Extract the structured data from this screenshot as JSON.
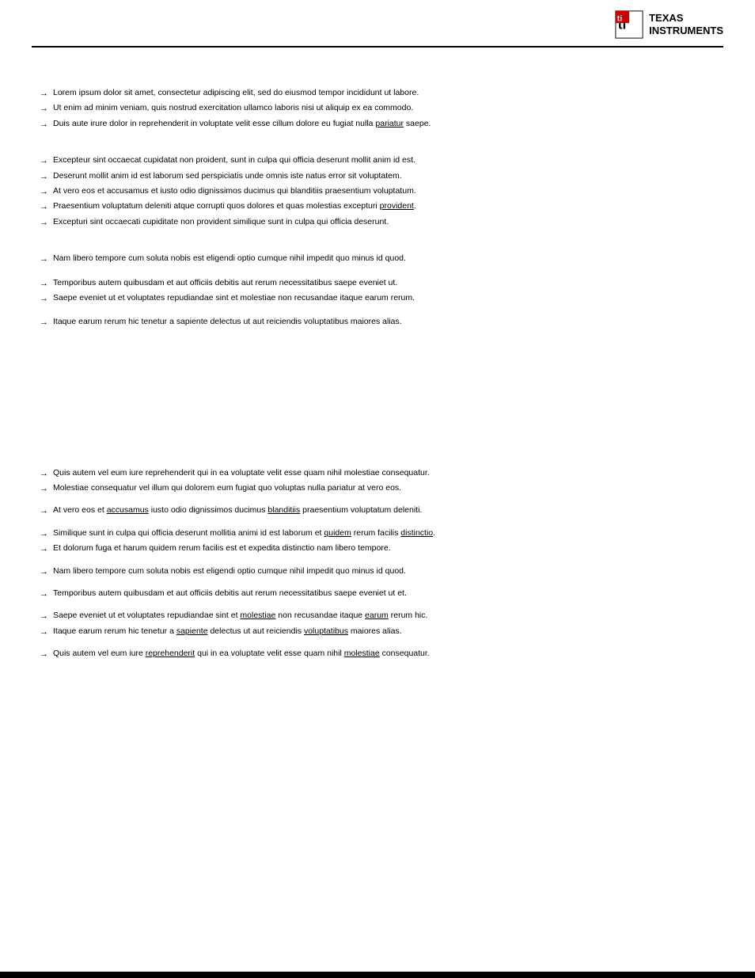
{
  "header": {
    "logo_text_line1": "TEXAS",
    "logo_text_line2": "INSTRUMENTS"
  },
  "top_rule": true,
  "sections": [
    {
      "id": "section1",
      "spacer_top": true,
      "title": "",
      "paragraphs": [],
      "bullets_groups": [
        {
          "items": [
            "Lorem ipsum dolor sit amet, consectetur adipiscing elit, sed do eiusmod tempor.",
            "Ut enim ad minim veniam, quis nostrud exercitation ullamco laboris nisi.",
            "Duis aute irure dolor in reprehenderit in voluptate velit esse cillum dolore eu fugiat nulla pariatur."
          ],
          "underline_word": "pariatur"
        }
      ]
    },
    {
      "id": "section2",
      "bullets_groups": [
        {
          "items": [
            "Excepteur sint occaecat cupidatat non proident, sunt in culpa qui officia.",
            "Deserunt mollit anim id est laborum sed perspiciatis unde omnis iste natus.",
            "At vero eos et accusamus et iusto odio dignissimos ducimus qui blanditiis.",
            "Praesentium voluptatum deleniti atque corrupti quos dolores et quas molestias.",
            "Excepturi sint occaecati cupiditate non provident similique sunt in culpa."
          ],
          "underline_word": "provident"
        }
      ]
    },
    {
      "id": "section3",
      "bullets_groups": [
        {
          "items": [
            "Nam libero tempore cum soluta nobis est eligendi optio cumque nihil impedit."
          ]
        },
        {
          "items": [
            "Temporibus autem quibusdam et aut officiis debitis rerum necessitatibus.",
            "Saepe eveniet ut et voluptates repudiandae sint et molestiae non recusandae."
          ]
        },
        {
          "items": [
            "Itaque earum rerum hic tenetur a sapiente delectus ut aut reiciendis voluptatibus."
          ]
        }
      ]
    }
  ],
  "large_spacer": true,
  "sections2": [
    {
      "id": "section4",
      "bullets_groups": [
        {
          "items": [
            "Quis autem vel eum iure reprehenderit qui in ea voluptate velit esse quam nihil.",
            "Molestiae consequatur vel illum qui dolorem eum fugiat quo voluptas nulla pariatur."
          ]
        },
        {
          "items": [
            "At vero eos et accusamus iusto odio dignissimos ducimus blanditiis praesentium."
          ],
          "underline_pairs": [
            "accusamus",
            "blanditiis"
          ]
        },
        {
          "items": [
            "Similique sunt in culpa qui officia deserunt mollitia animi id est laborum.",
            "Et dolorum fuga et harum quidem rerum facilis est et expedita distinctio."
          ],
          "underline_pairs": [
            "quidem",
            "distinctio"
          ]
        },
        {
          "items": [
            "Nam libero tempore cum soluta nobis est eligendi optio cumque nihil impedit."
          ]
        },
        {
          "items": [
            "Temporibus autem quibusdam et aut officiis debitis aut rerum necessitatibus."
          ]
        },
        {
          "items": [
            "Saepe eveniet ut et voluptates repudiandae sint et molestiae non recusandae.",
            "Itaque earum rerum hic tenetur sapiente delectus ut aut reiciendis voluptatibus."
          ],
          "underline_pairs2": [
            "earum",
            "sapiente"
          ]
        },
        {
          "items": [
            "Quis autem vel eum iure reprehenderit qui voluptate velit esse quam nihil molestiae."
          ],
          "underline_pairs3": [
            "reprehenderit",
            "molestiae"
          ]
        }
      ]
    }
  ]
}
